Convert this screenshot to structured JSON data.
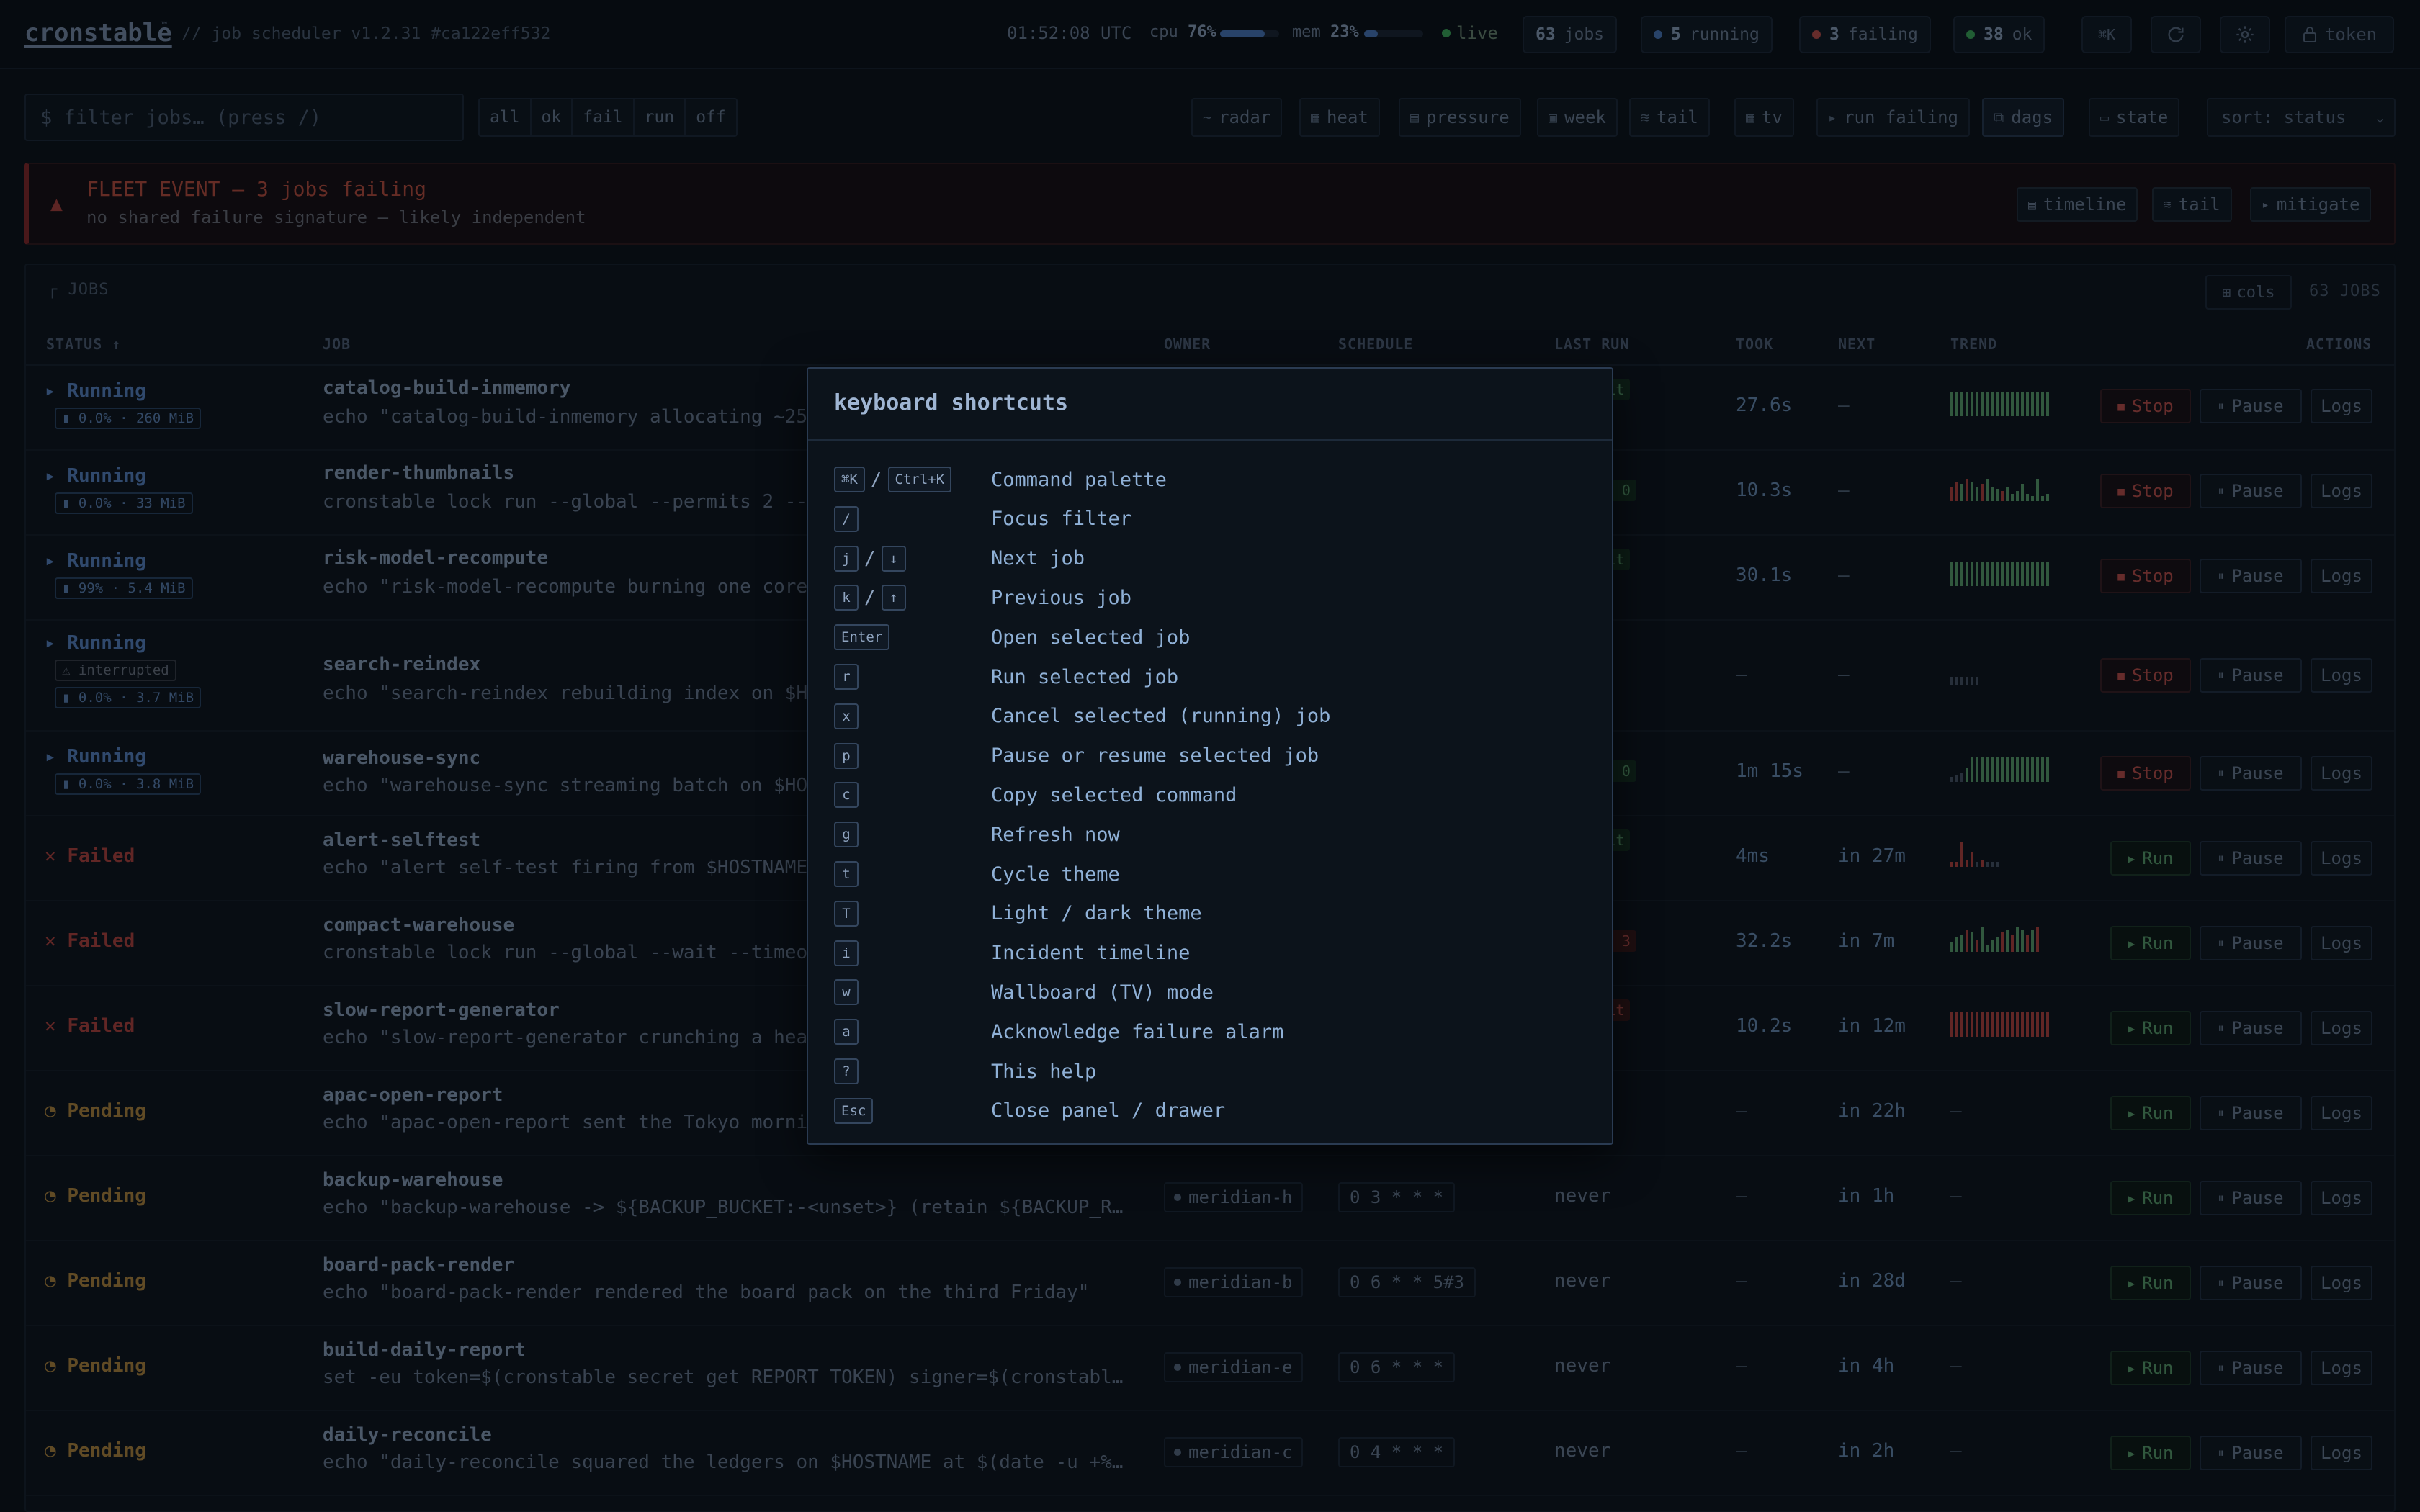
{
  "topbar": {
    "brand": "cronstable",
    "brand_tm": "™",
    "brand_sub": "// job scheduler  v1.2.31  #ca122eff532",
    "clock": "01:52:08 UTC",
    "cpu_label": "cpu",
    "cpu_value": "76%",
    "cpu_fraction": 0.76,
    "mem_label": "mem",
    "mem_value": "23%",
    "mem_fraction": 0.23,
    "live_label": "live",
    "counts": {
      "jobs_num": "63",
      "jobs_label": "jobs",
      "running_num": "5",
      "running_label": "running",
      "failing_num": "3",
      "failing_label": "failing",
      "ok_num": "38",
      "ok_label": "ok"
    },
    "cmd_icon": "⌘K",
    "token_label": "token"
  },
  "toolbar": {
    "filter_placeholder": "$ filter jobs… (press /)",
    "segments": [
      "all",
      "ok",
      "fail",
      "run",
      "off"
    ],
    "tools": {
      "radar": "radar",
      "heat": "heat",
      "pressure": "pressure",
      "week": "week",
      "tail": "tail",
      "tv": "tv",
      "run_failing": "run failing",
      "dags": "dags",
      "state": "state"
    },
    "sort": "sort: status"
  },
  "alert": {
    "title": "FLEET EVENT — 3 jobs failing",
    "subtitle": "no shared failure signature — likely independent",
    "timeline": "timeline",
    "tail": "tail",
    "mitigate": "mitigate"
  },
  "table": {
    "title": "JOBS",
    "cols_btn": "cols",
    "count": "63 JOBS",
    "headers": {
      "status": "STATUS ↑",
      "job": "JOB",
      "owner": "OWNER",
      "schedule": "SCHEDULE",
      "last_run": "LAST RUN",
      "took": "TOOK",
      "next": "NEXT",
      "trend": "TREND",
      "actions": "ACTIONS"
    },
    "labels": {
      "stop": "Stop",
      "run": "Run",
      "pause": "Pause",
      "logs": "Logs",
      "dash": "—"
    },
    "rows": [
      {
        "status": "Running",
        "chip": "▮ 0.0% · 260 MiB",
        "name": "catalog-build-inmemory",
        "cmd": "echo \"catalog-build-inmemory allocating ~25",
        "last_tail": "go",
        "exit": "exit",
        "exit_kind": "ok",
        "took": "27.6s",
        "next": "—"
      },
      {
        "status": "Running",
        "chip": "▮ 0.0% · 33 MiB",
        "name": "render-thumbnails",
        "cmd": "cronstable lock run --global --permits 2 --",
        "last_tail": "o",
        "exit": "exit 0",
        "exit_kind": "ok",
        "took": "10.3s",
        "next": "—"
      },
      {
        "status": "Running",
        "chip": "▮ 99% · 5.4 MiB",
        "name": "risk-model-recompute",
        "cmd": "echo \"risk-model-recompute burning one core",
        "last_tail": "go",
        "exit": "exit",
        "exit_kind": "ok",
        "took": "30.1s",
        "next": "—"
      },
      {
        "status": "Running",
        "chip_warn": "⚠ interrupted",
        "chip": "▮ 0.0% · 3.7 MiB",
        "name": "search-reindex",
        "cmd": "echo \"search-reindex rebuilding index on $H",
        "last_tail": "o",
        "exit": "",
        "exit_kind": "",
        "took": "—",
        "next": "—"
      },
      {
        "status": "Running",
        "chip": "▮ 0.0% · 3.8 MiB",
        "name": "warehouse-sync",
        "cmd": "echo \"warehouse-sync streaming batch on $HO",
        "last_tail": "o",
        "exit": "exit 0",
        "exit_kind": "ok",
        "took": "1m 15s",
        "next": "—"
      },
      {
        "status": "Failed",
        "name": "alert-selftest",
        "cmd": "echo \"alert self-test firing from $HOSTNAME",
        "last_tail": "go",
        "exit": "exit",
        "exit_kind": "bad",
        "took": "4ms",
        "next": "in 27m"
      },
      {
        "status": "Failed",
        "name": "compact-warehouse",
        "cmd": "cronstable lock run --global --wait --timeo",
        "last_tail": "o",
        "exit": "exit 3",
        "exit_kind": "bad",
        "took": "32.2s",
        "next": "in 7m"
      },
      {
        "status": "Failed",
        "name": "slow-report-generator",
        "cmd": "echo \"slow-report-generator crunching a hea",
        "last_tail": "go",
        "exit": "exit",
        "exit_kind": "bad",
        "took": "10.2s",
        "next": "in 12m"
      },
      {
        "status": "Pending",
        "name": "apac-open-report",
        "cmd": "echo \"apac-open-report sent the Tokyo morni",
        "took": "—",
        "next": "in 22h",
        "trend": "—"
      },
      {
        "status": "Pending",
        "name": "backup-warehouse",
        "cmd": "echo \"backup-warehouse -> ${BACKUP_BUCKET:-<unset>} (retain ${BACKUP_R…",
        "owner": "meridian-h",
        "schedule": "0 3 * * *",
        "last": "never",
        "took": "—",
        "next": "in 1h",
        "trend": "—"
      },
      {
        "status": "Pending",
        "name": "board-pack-render",
        "cmd": "echo \"board-pack-render rendered the board pack on the third Friday\"",
        "owner": "meridian-b",
        "schedule": "0 6 * * 5#3",
        "last": "never",
        "took": "—",
        "next": "in 28d",
        "trend": "—"
      },
      {
        "status": "Pending",
        "name": "build-daily-report",
        "cmd": "set -eu token=$(cronstable secret get REPORT_TOKEN) signer=$(cronstabl…",
        "owner": "meridian-e",
        "schedule": "0 6 * * *",
        "last": "never",
        "took": "—",
        "next": "in 4h",
        "trend": "—"
      },
      {
        "status": "Pending",
        "name": "daily-reconcile",
        "cmd": "echo \"daily-reconcile squared the ledgers on $HOSTNAME at $(date -u +%…",
        "owner": "meridian-c",
        "schedule": "0 4 * * *",
        "last": "never",
        "took": "—",
        "next": "in 2h",
        "trend": "—"
      }
    ]
  },
  "shortcuts": {
    "title": "keyboard shortcuts",
    "items": [
      {
        "keys": [
          "⌘K",
          "Ctrl+K"
        ],
        "desc": "Command palette"
      },
      {
        "keys": [
          "/"
        ],
        "desc": "Focus filter"
      },
      {
        "keys": [
          "j",
          "↓"
        ],
        "desc": "Next job"
      },
      {
        "keys": [
          "k",
          "↑"
        ],
        "desc": "Previous job"
      },
      {
        "keys": [
          "Enter"
        ],
        "desc": "Open selected job"
      },
      {
        "keys": [
          "r"
        ],
        "desc": "Run selected job"
      },
      {
        "keys": [
          "x"
        ],
        "desc": "Cancel selected (running) job"
      },
      {
        "keys": [
          "p"
        ],
        "desc": "Pause or resume selected job"
      },
      {
        "keys": [
          "c"
        ],
        "desc": "Copy selected command"
      },
      {
        "keys": [
          "g"
        ],
        "desc": "Refresh now"
      },
      {
        "keys": [
          "t"
        ],
        "desc": "Cycle theme"
      },
      {
        "keys": [
          "T"
        ],
        "desc": "Light / dark theme"
      },
      {
        "keys": [
          "i"
        ],
        "desc": "Incident timeline"
      },
      {
        "keys": [
          "w"
        ],
        "desc": "Wallboard (TV) mode"
      },
      {
        "keys": [
          "a"
        ],
        "desc": "Acknowledge failure alarm"
      },
      {
        "keys": [
          "?"
        ],
        "desc": "This help"
      },
      {
        "keys": [
          "Esc"
        ],
        "desc": "Close panel / drawer"
      }
    ]
  },
  "colors": {
    "accent": "#5b87c8",
    "failed": "#b9443f",
    "pending": "#b98a3f",
    "ok": "#5da46e"
  }
}
